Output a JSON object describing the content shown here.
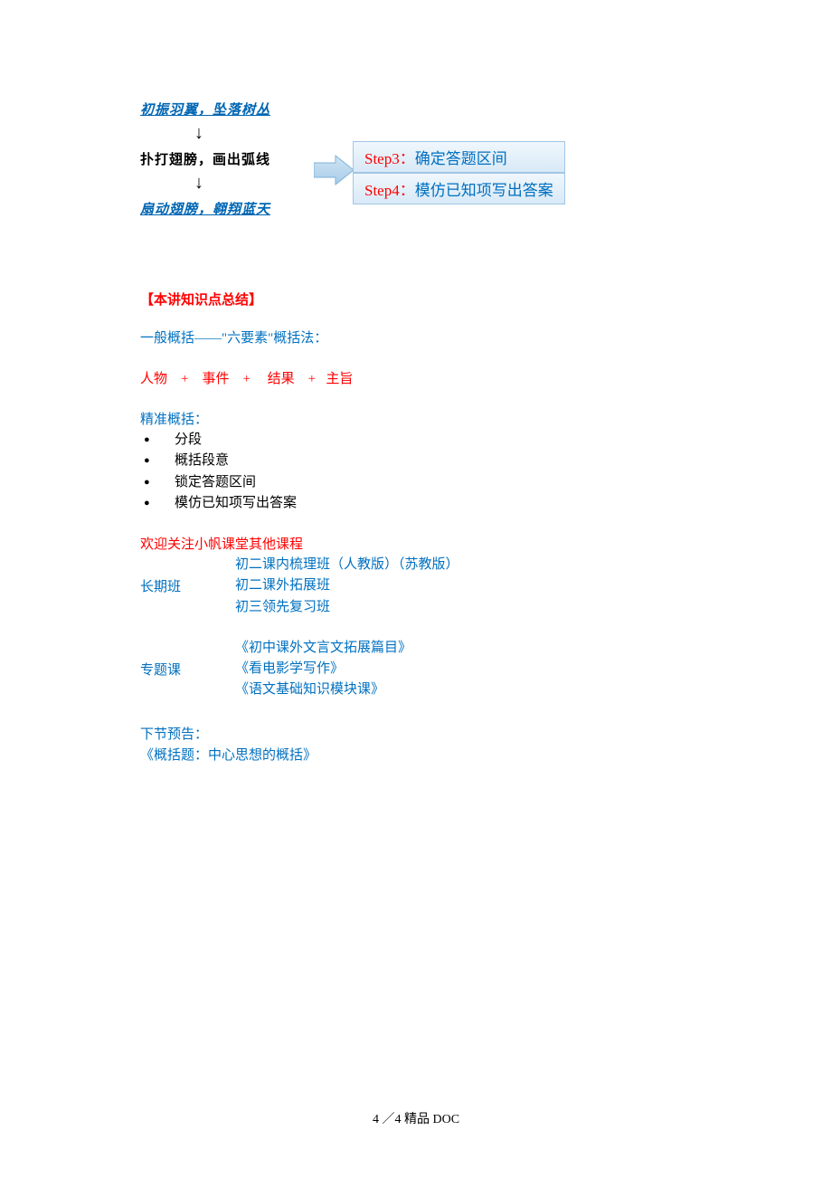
{
  "diagram": {
    "row1": "初振羽翼，坠落树丛",
    "row2": "扑打翅膀，画出弧线",
    "row3": "扇动翅膀，翱翔蓝天"
  },
  "steps": {
    "s3_label": "Step3",
    "s3_colon": "：",
    "s3_text": "确定答题区间",
    "s4_label": "Step4",
    "s4_colon": "：",
    "s4_text": "模仿已知项写出答案"
  },
  "summary_heading": "【本讲知识点总结】",
  "general_line": "一般概括——\"六要素\"概括法：",
  "formula": "人物    +    事件    +     结果    +   主旨",
  "precise_label": "精准概括：",
  "bullets": {
    "b1": "分段",
    "b2": "概括段意",
    "b3": "锁定答题区间",
    "b4": "模仿已知项写出答案"
  },
  "welcome_line": "欢迎关注小帆课堂其他课程",
  "courses": {
    "long_label": "长期班",
    "long_items": {
      "i1": "初二课内梳理班（人教版）（苏教版）",
      "i2": "初二课外拓展班",
      "i3": "初三领先复习班"
    },
    "topic_label": "专题课",
    "topic_items": {
      "i1": "《初中课外文言文拓展篇目》",
      "i2": "《看电影学写作》",
      "i3": "《语文基础知识模块课》"
    }
  },
  "preview": {
    "p1": "下节预告：",
    "p2": "《概括题：中心思想的概括》"
  },
  "footer": "4 ／4 精品 DOC"
}
